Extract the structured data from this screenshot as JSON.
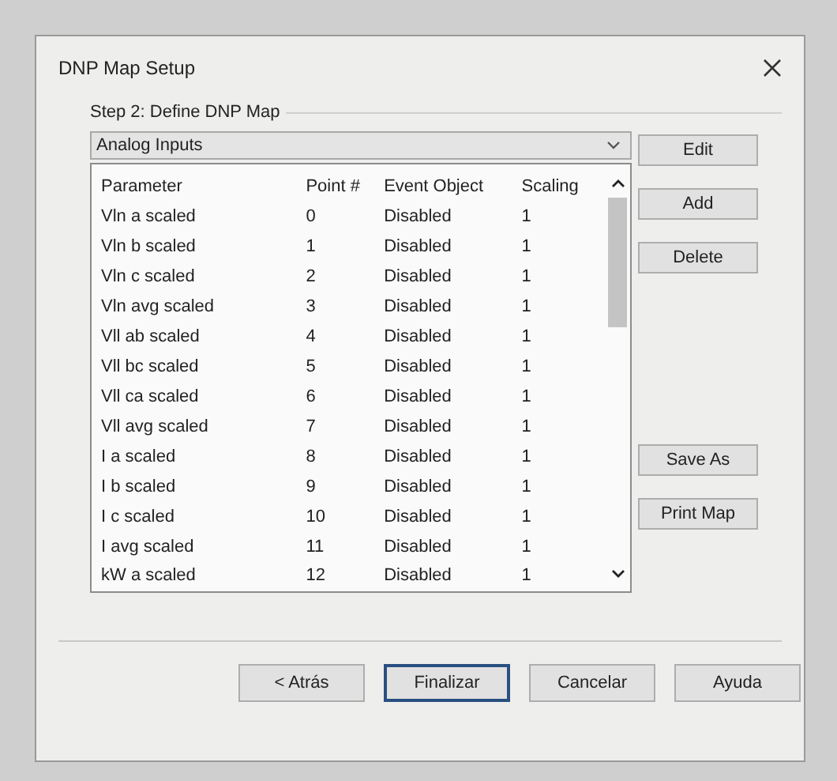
{
  "window": {
    "title": "DNP Map Setup"
  },
  "step_label": "Step 2: Define DNP Map",
  "type_dropdown": {
    "value": "Analog Inputs"
  },
  "table": {
    "columns": [
      "Parameter",
      "Point #",
      "Event Object",
      "Scaling"
    ],
    "rows": [
      [
        "Vln a scaled",
        "0",
        "Disabled",
        "1"
      ],
      [
        "Vln b scaled",
        "1",
        "Disabled",
        "1"
      ],
      [
        "Vln c scaled",
        "2",
        "Disabled",
        "1"
      ],
      [
        "Vln avg scaled",
        "3",
        "Disabled",
        "1"
      ],
      [
        "Vll ab scaled",
        "4",
        "Disabled",
        "1"
      ],
      [
        "Vll bc scaled",
        "5",
        "Disabled",
        "1"
      ],
      [
        "Vll ca scaled",
        "6",
        "Disabled",
        "1"
      ],
      [
        "Vll avg scaled",
        "7",
        "Disabled",
        "1"
      ],
      [
        "I a scaled",
        "8",
        "Disabled",
        "1"
      ],
      [
        "I b scaled",
        "9",
        "Disabled",
        "1"
      ],
      [
        "I c scaled",
        "10",
        "Disabled",
        "1"
      ],
      [
        "I avg scaled",
        "11",
        "Disabled",
        "1"
      ],
      [
        "kW a scaled",
        "12",
        "Disabled",
        "1"
      ]
    ]
  },
  "side_buttons_top": [
    "Edit",
    "Add",
    "Delete"
  ],
  "side_buttons_bottom": [
    "Save As",
    "Print Map"
  ],
  "footer_buttons": [
    {
      "label": "< Atrás",
      "default": false
    },
    {
      "label": "Finalizar",
      "default": true
    },
    {
      "label": "Cancelar",
      "default": false
    },
    {
      "label": "Ayuda",
      "default": false
    }
  ]
}
